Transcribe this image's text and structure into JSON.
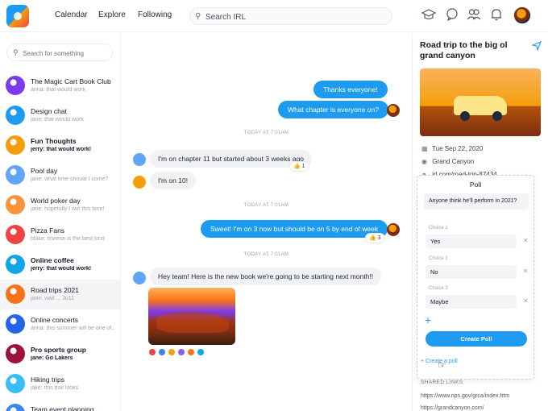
{
  "header": {
    "nav": [
      "Calendar",
      "Explore",
      "Following"
    ],
    "search_placeholder": "Search IRL",
    "icons": [
      "mortarboard-icon",
      "chat-bubble-icon",
      "people-icon",
      "bell-icon"
    ]
  },
  "sidebar": {
    "search_placeholder": "Search for something",
    "chats": [
      {
        "name": "The Magic Cart Book Club",
        "preview": "anna: that would work",
        "bold": false,
        "active": false,
        "color": "#7c3aed"
      },
      {
        "name": "Design chat",
        "preview": "jane: that would work",
        "bold": false,
        "active": false,
        "color": "#1d9bf0"
      },
      {
        "name": "Fun Thoughts",
        "preview": "jerry: that would work!",
        "bold": true,
        "active": false,
        "color": "#f59e0b"
      },
      {
        "name": "Pool day",
        "preview": "jane: what time should I come?",
        "bold": false,
        "active": false,
        "color": "#60a5fa"
      },
      {
        "name": "World poker day",
        "preview": "jane: hopefully I win this time!",
        "bold": false,
        "active": false,
        "color": "#fb923c"
      },
      {
        "name": "Pizza Fans",
        "preview": "blake: cheese is the best kind",
        "bold": false,
        "active": false,
        "color": "#ef4444"
      },
      {
        "name": "Online coffee",
        "preview": "jerry: that would work!",
        "bold": true,
        "active": false,
        "color": "#0ea5e9"
      },
      {
        "name": "Road trips 2021",
        "preview": "jane: wait ... Ju11",
        "bold": false,
        "active": true,
        "color": "#f97316"
      },
      {
        "name": "Online concerts",
        "preview": "anna: this summer will be one of...",
        "bold": false,
        "active": false,
        "color": "#2563eb"
      },
      {
        "name": "Pro sports group",
        "preview": "jane: Go Lakers",
        "bold": true,
        "active": false,
        "color": "#9f1239"
      },
      {
        "name": "Hiking trips",
        "preview": "jake: this trail looks",
        "bold": false,
        "active": false,
        "color": "#38bdf8"
      },
      {
        "name": "Team event planning",
        "preview": "",
        "bold": false,
        "active": false,
        "color": "#3b82f6"
      }
    ]
  },
  "chat": {
    "messages_out_1": "Thanks everyone!",
    "messages_out_2": "What chapter is everyone on?",
    "stamp_1": "TODAY AT 7:01AM",
    "msg_in_1": "I'm on chapter 11 but started about 3 weeks ago",
    "react_1": "👍 1",
    "msg_in_2": "I'm on 10!",
    "stamp_2": "TODAY AT 7:01AM",
    "msg_out_3": "Sweet! I'm on 3 now but should be on 5 by end of week",
    "react_2": "👍 3",
    "stamp_3": "TODAY AT 7:01AM",
    "msg_in_3": "Hey team! Here is the new book we're going to be starting next month!!"
  },
  "panel": {
    "title": "Road trip to the big ol grand canyon",
    "date": "Tue Sep 22, 2020",
    "location": "Grand Canyon",
    "link_partial": "irl.com/road-trip-87434",
    "poll": {
      "header": "Poll",
      "question": "Anyone think he'll perform in 2021?",
      "choices": [
        {
          "label": "Choice 1",
          "value": "Yes"
        },
        {
          "label": "Choice 2",
          "value": "No"
        },
        {
          "label": "Choice 3",
          "value": "Maybe"
        }
      ],
      "create_button": "Create Poll"
    },
    "create_link": "+ Create a poll",
    "shared_links_label": "SHARED LINKS",
    "links": [
      "https://www.nps.gov/grca/index.htm",
      "https://grandcanyon.com/"
    ]
  }
}
